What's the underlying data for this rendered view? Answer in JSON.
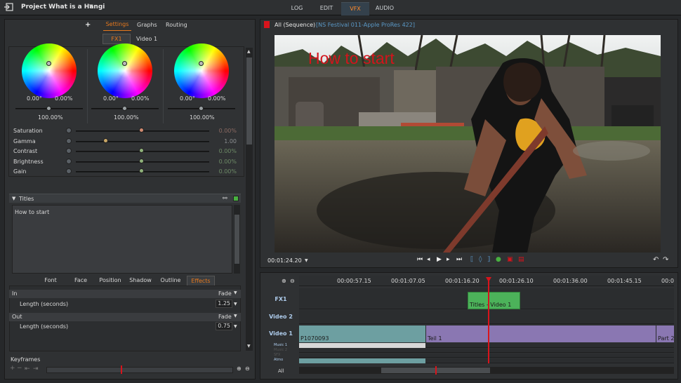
{
  "topbar": {
    "project_title": "Project What is a Hangi",
    "tabs": [
      {
        "label": "LOG"
      },
      {
        "label": "EDIT"
      },
      {
        "label": "VFX"
      },
      {
        "label": "AUDIO"
      }
    ]
  },
  "left_panel": {
    "add_button": "+",
    "tabs": [
      {
        "label": "Settings"
      },
      {
        "label": "Graphs"
      },
      {
        "label": "Routing"
      }
    ],
    "subtabs": [
      {
        "label": "FX1"
      },
      {
        "label": "Video 1"
      }
    ],
    "wheels": [
      {
        "angle": "0.00°",
        "amount": "0.00%",
        "level": "100.00%"
      },
      {
        "angle": "0.00°",
        "amount": "0.00%",
        "level": "100.00%"
      },
      {
        "angle": "0.00°",
        "amount": "0.00%",
        "level": "100.00%"
      }
    ],
    "adjustments": [
      {
        "label": "Saturation",
        "value": "0.00%"
      },
      {
        "label": "Gamma",
        "value": "1.00"
      },
      {
        "label": "Contrast",
        "value": "0.00%"
      },
      {
        "label": "Brightness",
        "value": "0.00%"
      },
      {
        "label": "Gain",
        "value": "0.00%"
      }
    ],
    "titles_header": "Titles",
    "titles_text": "How to start",
    "text_tabs": [
      {
        "label": "Font"
      },
      {
        "label": "Face"
      },
      {
        "label": "Position"
      },
      {
        "label": "Shadow"
      },
      {
        "label": "Outline"
      },
      {
        "label": "Effects"
      }
    ],
    "in_label": "In",
    "in_mode": "Fade",
    "in_length_label": "Length (seconds)",
    "in_length": "1.25",
    "out_label": "Out",
    "out_mode": "Fade",
    "out_length_label": "Length (seconds)",
    "out_length": "0.75",
    "keyframes_label": "Keyframes"
  },
  "viewer": {
    "sequence_label": "All (Sequence)",
    "sequence_info": "[NS Festival 011-Apple ProRes 422]",
    "overlay_title": "How to start",
    "timecode": "00:01:24.20"
  },
  "timeline": {
    "ruler": [
      "00:00:57.15",
      "00:01:07.05",
      "00:01:16.20",
      "00:01:26.10",
      "00:01:36.00",
      "00:01:45.15",
      "00:0"
    ],
    "tracks": [
      {
        "label": "FX1"
      },
      {
        "label": "Video 2"
      },
      {
        "label": "Video 1"
      }
    ],
    "audio_tracks": [
      {
        "label": "Music 1"
      },
      {
        "label": "Music 2"
      },
      {
        "label": "SFX"
      },
      {
        "label": "Atmo"
      }
    ],
    "all_label": "All",
    "clips": {
      "titles": "Titles - Video 1",
      "p1": "P1070093",
      "teil": "Teil 1",
      "part2": "Part 2"
    }
  },
  "colors": {
    "accent": "#e5781d",
    "fx_clip": "#4cb25a",
    "video_clip_a": "#6d9fa1",
    "video_clip_b": "#8a77b2",
    "playhead": "#d8141c"
  }
}
